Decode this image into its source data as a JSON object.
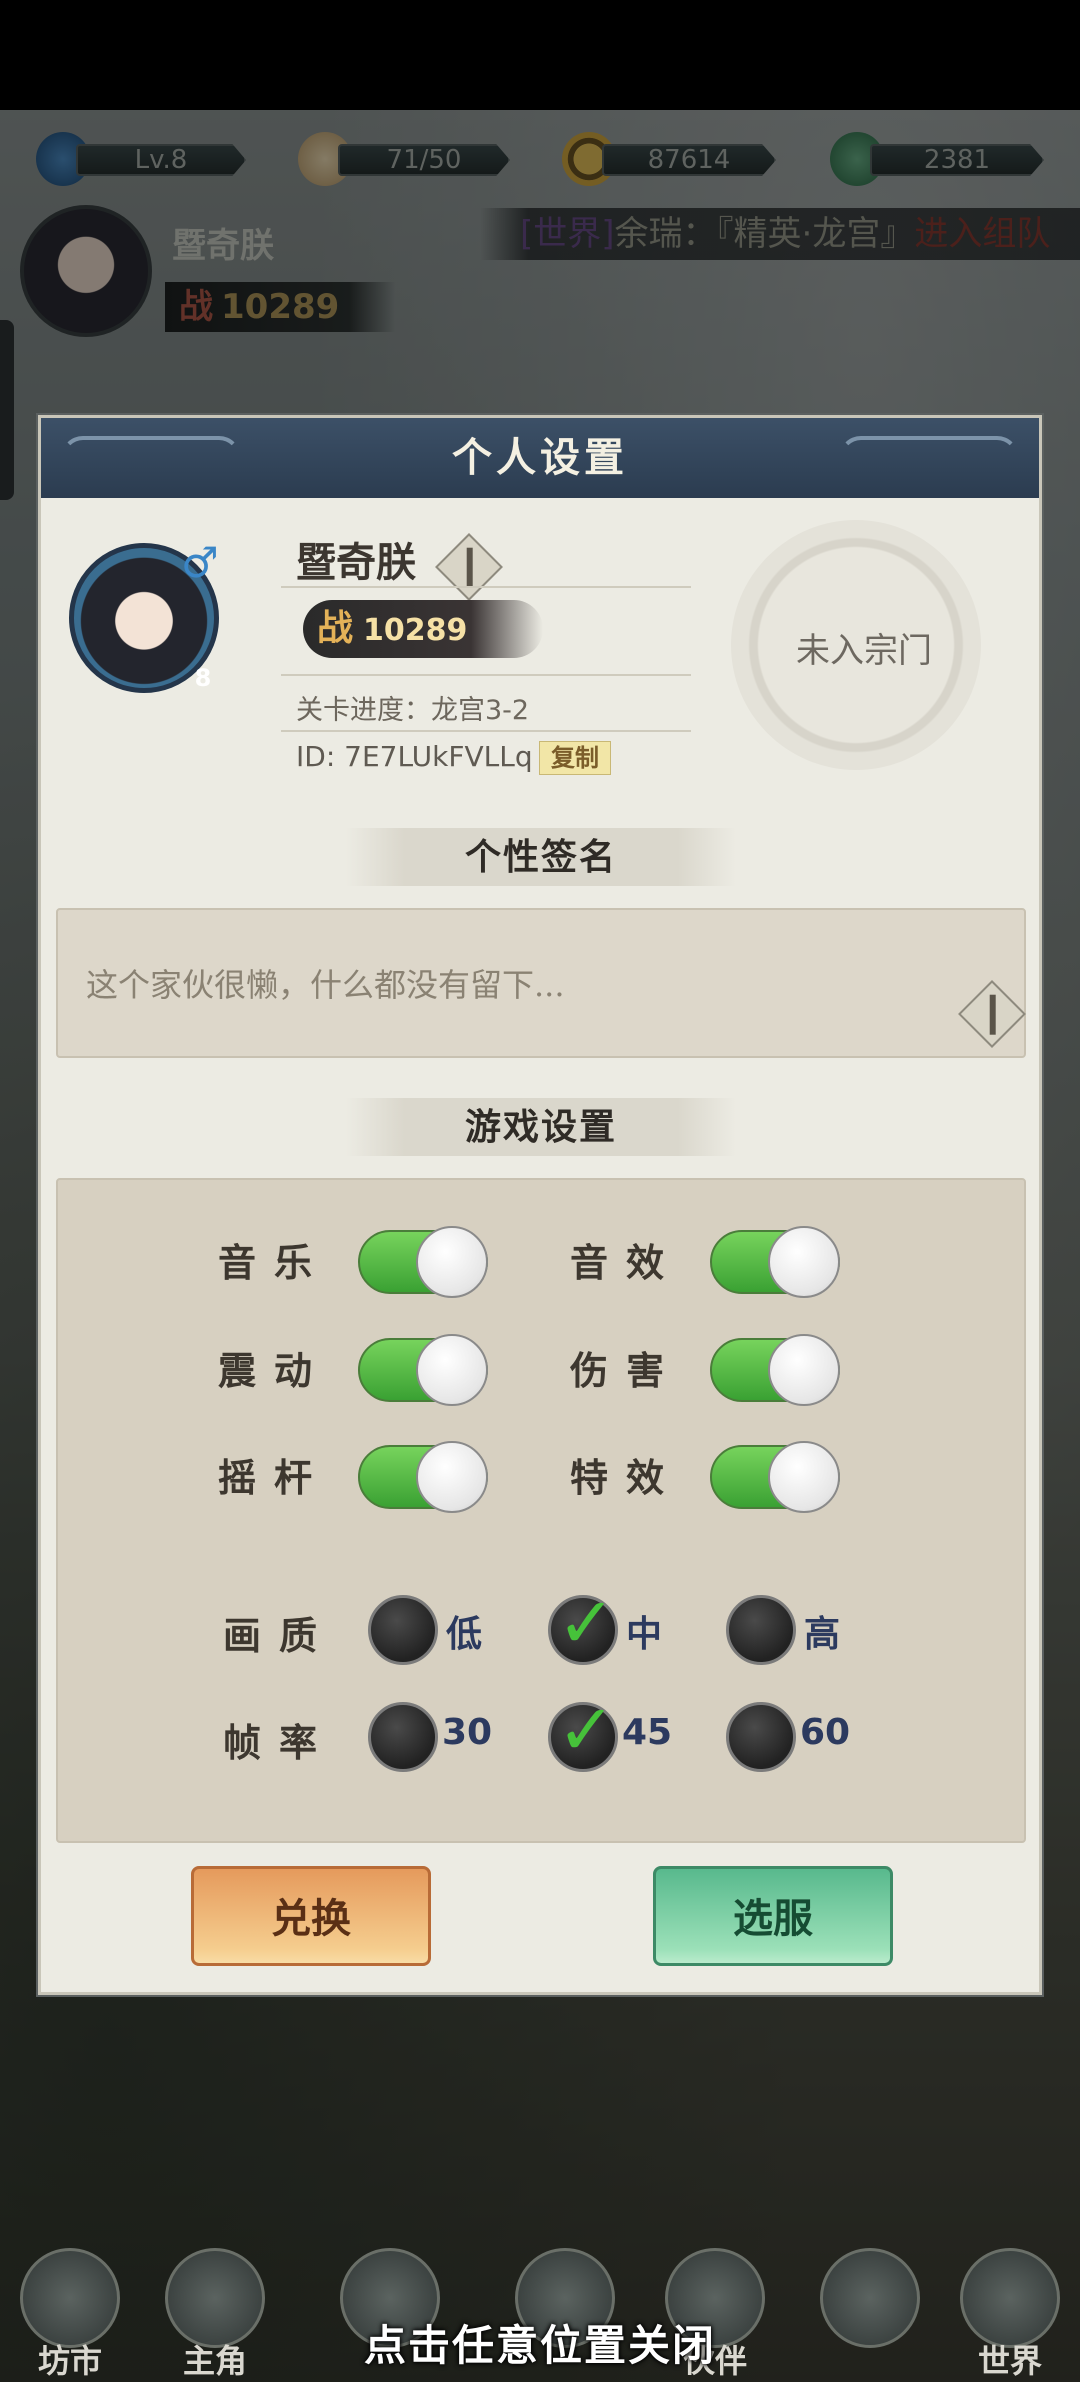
{
  "resources": [
    {
      "icon": "dragon-icon",
      "value": "Lv.8"
    },
    {
      "icon": "bun-icon",
      "value": "71/50"
    },
    {
      "icon": "coin-icon",
      "value": "87614"
    },
    {
      "icon": "jade-icon",
      "value": "2381"
    }
  ],
  "header": {
    "name": "暨奇朕",
    "power_label": "战",
    "power": "10289"
  },
  "marquee": {
    "channel": "[世界]",
    "text": "余瑞：『精英·龙宫』",
    "tail": "进入组队"
  },
  "panel": {
    "title": "个人设置",
    "profile": {
      "name": "暨奇朕",
      "level": "8",
      "gender_symbol": "♂",
      "power_label": "战",
      "power": "10289",
      "stage": "关卡进度：龙宫3-2",
      "id": "ID: 7E7LUkFVLLq",
      "copy_label": "复制",
      "sect": "未入宗门"
    },
    "signature": {
      "heading": "个性签名",
      "text": "这个家伙很懒，什么都没有留下..."
    },
    "game_settings": {
      "heading": "游戏设置",
      "toggles": [
        {
          "label": "音乐",
          "on": true
        },
        {
          "label": "音效",
          "on": true
        },
        {
          "label": "震动",
          "on": true
        },
        {
          "label": "伤害",
          "on": true
        },
        {
          "label": "摇杆",
          "on": true
        },
        {
          "label": "特效",
          "on": true
        }
      ],
      "quality": {
        "label": "画质",
        "options": [
          "低",
          "中",
          "高"
        ],
        "selected": "中"
      },
      "framerate": {
        "label": "帧率",
        "options": [
          "30",
          "45",
          "60"
        ],
        "selected": "45"
      }
    },
    "buttons": {
      "exchange": "兑换",
      "server": "选服"
    }
  },
  "bottom_nav": [
    {
      "label": "坊市"
    },
    {
      "label": "主角"
    },
    {
      "label": ""
    },
    {
      "label": ""
    },
    {
      "label": "伙伴"
    },
    {
      "label": ""
    },
    {
      "label": "世界"
    }
  ],
  "close_hint": "点击任意位置关闭"
}
